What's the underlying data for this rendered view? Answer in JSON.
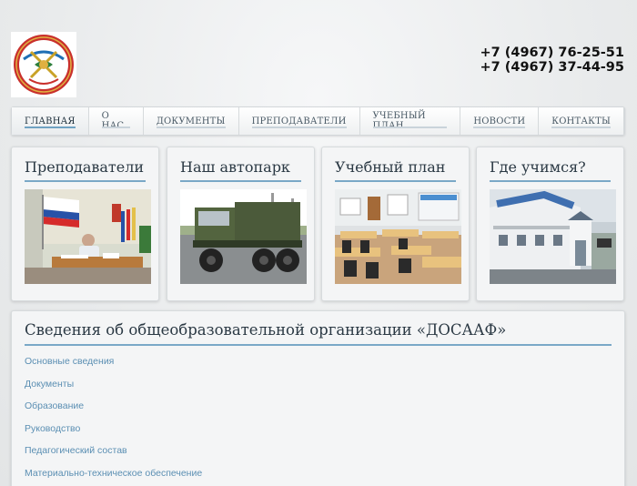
{
  "header": {
    "logo_icon": "dosaaf-emblem-icon",
    "phones": [
      "+7 (4967) 76-25-51",
      "+7 (4967) 37-44-95"
    ]
  },
  "nav": {
    "items": [
      {
        "label": "Главная",
        "active": true
      },
      {
        "label": "О нас",
        "active": false
      },
      {
        "label": "Документы",
        "active": false
      },
      {
        "label": "Преподаватели",
        "active": false
      },
      {
        "label": "Учебный план",
        "active": false
      },
      {
        "label": "Новости",
        "active": false
      },
      {
        "label": "Контакты",
        "active": false
      }
    ]
  },
  "cards": [
    {
      "title": "Преподаватели",
      "image": "office-with-instructor-photo"
    },
    {
      "title": "Наш автопарк",
      "image": "military-truck-photo"
    },
    {
      "title": "Учебный план",
      "image": "classroom-photo"
    },
    {
      "title": "Где учимся?",
      "image": "dosaaf-building-photo"
    }
  ],
  "info": {
    "title": "Сведения об общеобразовательной организации «ДОСААФ»",
    "links": [
      "Основные сведения",
      "Документы",
      "Образование",
      "Руководство",
      "Педагогический состав",
      "Материально-техническое обеспечение"
    ]
  },
  "colors": {
    "accent": "#7aa8c7",
    "link": "#5b8fb3",
    "heading": "#2b3944"
  }
}
